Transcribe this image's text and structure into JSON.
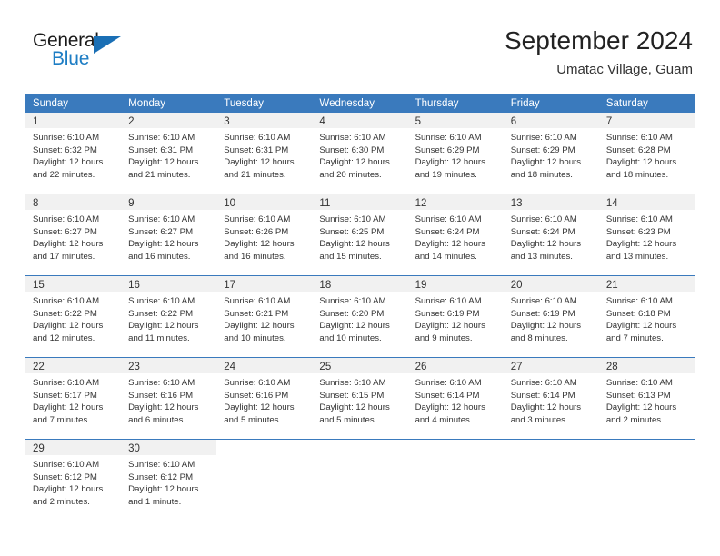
{
  "logo": {
    "word_top": "General",
    "word_bottom": "Blue",
    "triangle_icon": "triangle-icon",
    "accent_color": "#1d7dc4"
  },
  "header": {
    "title": "September 2024",
    "subtitle": "Umatac Village, Guam"
  },
  "theme": {
    "header_blue": "#3a7abd",
    "daynum_band": "#f1f1f1",
    "text": "#333333"
  },
  "weekdays": [
    "Sunday",
    "Monday",
    "Tuesday",
    "Wednesday",
    "Thursday",
    "Friday",
    "Saturday"
  ],
  "weeks": [
    [
      {
        "day": "1",
        "sunrise": "Sunrise: 6:10 AM",
        "sunset": "Sunset: 6:32 PM",
        "daylight_line1": "Daylight: 12 hours",
        "daylight_line2": "and 22 minutes."
      },
      {
        "day": "2",
        "sunrise": "Sunrise: 6:10 AM",
        "sunset": "Sunset: 6:31 PM",
        "daylight_line1": "Daylight: 12 hours",
        "daylight_line2": "and 21 minutes."
      },
      {
        "day": "3",
        "sunrise": "Sunrise: 6:10 AM",
        "sunset": "Sunset: 6:31 PM",
        "daylight_line1": "Daylight: 12 hours",
        "daylight_line2": "and 21 minutes."
      },
      {
        "day": "4",
        "sunrise": "Sunrise: 6:10 AM",
        "sunset": "Sunset: 6:30 PM",
        "daylight_line1": "Daylight: 12 hours",
        "daylight_line2": "and 20 minutes."
      },
      {
        "day": "5",
        "sunrise": "Sunrise: 6:10 AM",
        "sunset": "Sunset: 6:29 PM",
        "daylight_line1": "Daylight: 12 hours",
        "daylight_line2": "and 19 minutes."
      },
      {
        "day": "6",
        "sunrise": "Sunrise: 6:10 AM",
        "sunset": "Sunset: 6:29 PM",
        "daylight_line1": "Daylight: 12 hours",
        "daylight_line2": "and 18 minutes."
      },
      {
        "day": "7",
        "sunrise": "Sunrise: 6:10 AM",
        "sunset": "Sunset: 6:28 PM",
        "daylight_line1": "Daylight: 12 hours",
        "daylight_line2": "and 18 minutes."
      }
    ],
    [
      {
        "day": "8",
        "sunrise": "Sunrise: 6:10 AM",
        "sunset": "Sunset: 6:27 PM",
        "daylight_line1": "Daylight: 12 hours",
        "daylight_line2": "and 17 minutes."
      },
      {
        "day": "9",
        "sunrise": "Sunrise: 6:10 AM",
        "sunset": "Sunset: 6:27 PM",
        "daylight_line1": "Daylight: 12 hours",
        "daylight_line2": "and 16 minutes."
      },
      {
        "day": "10",
        "sunrise": "Sunrise: 6:10 AM",
        "sunset": "Sunset: 6:26 PM",
        "daylight_line1": "Daylight: 12 hours",
        "daylight_line2": "and 16 minutes."
      },
      {
        "day": "11",
        "sunrise": "Sunrise: 6:10 AM",
        "sunset": "Sunset: 6:25 PM",
        "daylight_line1": "Daylight: 12 hours",
        "daylight_line2": "and 15 minutes."
      },
      {
        "day": "12",
        "sunrise": "Sunrise: 6:10 AM",
        "sunset": "Sunset: 6:24 PM",
        "daylight_line1": "Daylight: 12 hours",
        "daylight_line2": "and 14 minutes."
      },
      {
        "day": "13",
        "sunrise": "Sunrise: 6:10 AM",
        "sunset": "Sunset: 6:24 PM",
        "daylight_line1": "Daylight: 12 hours",
        "daylight_line2": "and 13 minutes."
      },
      {
        "day": "14",
        "sunrise": "Sunrise: 6:10 AM",
        "sunset": "Sunset: 6:23 PM",
        "daylight_line1": "Daylight: 12 hours",
        "daylight_line2": "and 13 minutes."
      }
    ],
    [
      {
        "day": "15",
        "sunrise": "Sunrise: 6:10 AM",
        "sunset": "Sunset: 6:22 PM",
        "daylight_line1": "Daylight: 12 hours",
        "daylight_line2": "and 12 minutes."
      },
      {
        "day": "16",
        "sunrise": "Sunrise: 6:10 AM",
        "sunset": "Sunset: 6:22 PM",
        "daylight_line1": "Daylight: 12 hours",
        "daylight_line2": "and 11 minutes."
      },
      {
        "day": "17",
        "sunrise": "Sunrise: 6:10 AM",
        "sunset": "Sunset: 6:21 PM",
        "daylight_line1": "Daylight: 12 hours",
        "daylight_line2": "and 10 minutes."
      },
      {
        "day": "18",
        "sunrise": "Sunrise: 6:10 AM",
        "sunset": "Sunset: 6:20 PM",
        "daylight_line1": "Daylight: 12 hours",
        "daylight_line2": "and 10 minutes."
      },
      {
        "day": "19",
        "sunrise": "Sunrise: 6:10 AM",
        "sunset": "Sunset: 6:19 PM",
        "daylight_line1": "Daylight: 12 hours",
        "daylight_line2": "and 9 minutes."
      },
      {
        "day": "20",
        "sunrise": "Sunrise: 6:10 AM",
        "sunset": "Sunset: 6:19 PM",
        "daylight_line1": "Daylight: 12 hours",
        "daylight_line2": "and 8 minutes."
      },
      {
        "day": "21",
        "sunrise": "Sunrise: 6:10 AM",
        "sunset": "Sunset: 6:18 PM",
        "daylight_line1": "Daylight: 12 hours",
        "daylight_line2": "and 7 minutes."
      }
    ],
    [
      {
        "day": "22",
        "sunrise": "Sunrise: 6:10 AM",
        "sunset": "Sunset: 6:17 PM",
        "daylight_line1": "Daylight: 12 hours",
        "daylight_line2": "and 7 minutes."
      },
      {
        "day": "23",
        "sunrise": "Sunrise: 6:10 AM",
        "sunset": "Sunset: 6:16 PM",
        "daylight_line1": "Daylight: 12 hours",
        "daylight_line2": "and 6 minutes."
      },
      {
        "day": "24",
        "sunrise": "Sunrise: 6:10 AM",
        "sunset": "Sunset: 6:16 PM",
        "daylight_line1": "Daylight: 12 hours",
        "daylight_line2": "and 5 minutes."
      },
      {
        "day": "25",
        "sunrise": "Sunrise: 6:10 AM",
        "sunset": "Sunset: 6:15 PM",
        "daylight_line1": "Daylight: 12 hours",
        "daylight_line2": "and 5 minutes."
      },
      {
        "day": "26",
        "sunrise": "Sunrise: 6:10 AM",
        "sunset": "Sunset: 6:14 PM",
        "daylight_line1": "Daylight: 12 hours",
        "daylight_line2": "and 4 minutes."
      },
      {
        "day": "27",
        "sunrise": "Sunrise: 6:10 AM",
        "sunset": "Sunset: 6:14 PM",
        "daylight_line1": "Daylight: 12 hours",
        "daylight_line2": "and 3 minutes."
      },
      {
        "day": "28",
        "sunrise": "Sunrise: 6:10 AM",
        "sunset": "Sunset: 6:13 PM",
        "daylight_line1": "Daylight: 12 hours",
        "daylight_line2": "and 2 minutes."
      }
    ],
    [
      {
        "day": "29",
        "sunrise": "Sunrise: 6:10 AM",
        "sunset": "Sunset: 6:12 PM",
        "daylight_line1": "Daylight: 12 hours",
        "daylight_line2": "and 2 minutes."
      },
      {
        "day": "30",
        "sunrise": "Sunrise: 6:10 AM",
        "sunset": "Sunset: 6:12 PM",
        "daylight_line1": "Daylight: 12 hours",
        "daylight_line2": "and 1 minute."
      },
      {
        "day": "",
        "sunrise": "",
        "sunset": "",
        "daylight_line1": "",
        "daylight_line2": ""
      },
      {
        "day": "",
        "sunrise": "",
        "sunset": "",
        "daylight_line1": "",
        "daylight_line2": ""
      },
      {
        "day": "",
        "sunrise": "",
        "sunset": "",
        "daylight_line1": "",
        "daylight_line2": ""
      },
      {
        "day": "",
        "sunrise": "",
        "sunset": "",
        "daylight_line1": "",
        "daylight_line2": ""
      },
      {
        "day": "",
        "sunrise": "",
        "sunset": "",
        "daylight_line1": "",
        "daylight_line2": ""
      }
    ]
  ]
}
